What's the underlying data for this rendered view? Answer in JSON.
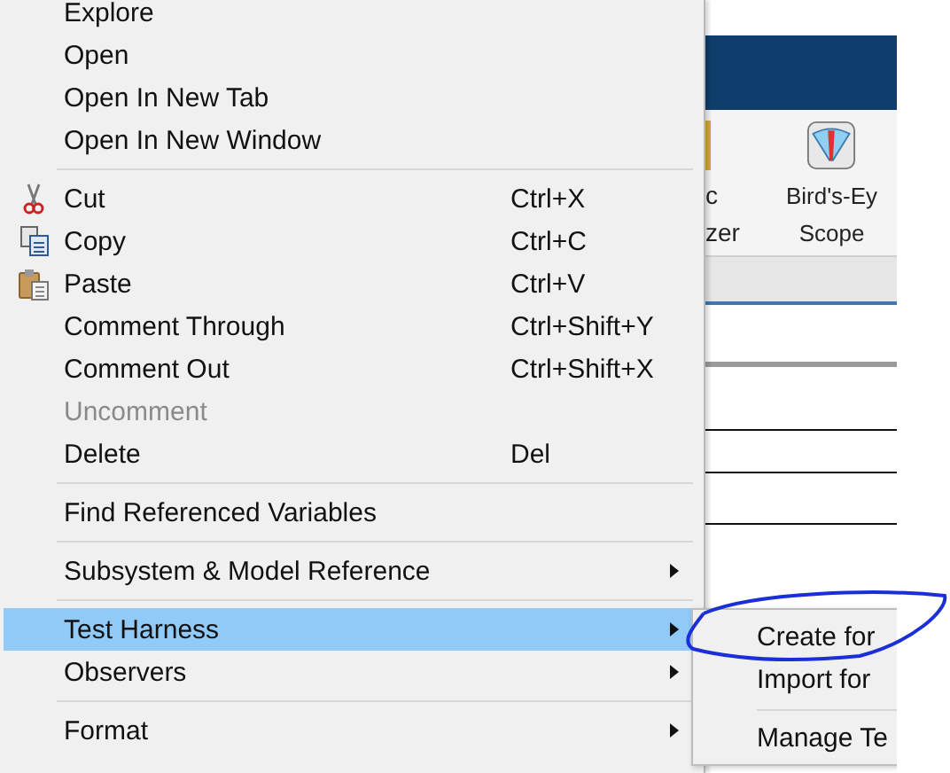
{
  "background_window": {
    "toolbar_buttons": [
      {
        "lines": [
          "c",
          "zer"
        ]
      },
      {
        "lines": [
          "Bird's-Ey",
          "Scope"
        ]
      }
    ]
  },
  "menu": {
    "items": [
      {
        "kind": "item",
        "label": "Explore",
        "disabled": false,
        "selected": false,
        "submenu": false
      },
      {
        "kind": "item",
        "label": "Open",
        "disabled": false,
        "selected": false,
        "submenu": false
      },
      {
        "kind": "item",
        "label": "Open In New Tab",
        "disabled": false,
        "selected": false,
        "submenu": false
      },
      {
        "kind": "item",
        "label": "Open In New Window",
        "disabled": false,
        "selected": false,
        "submenu": false
      },
      {
        "kind": "separator"
      },
      {
        "kind": "item",
        "label": "Cut",
        "shortcut": "Ctrl+X",
        "disabled": false,
        "selected": false,
        "submenu": false
      },
      {
        "kind": "item",
        "label": "Copy",
        "shortcut": "Ctrl+C",
        "disabled": false,
        "selected": false,
        "submenu": false
      },
      {
        "kind": "item",
        "label": "Paste",
        "shortcut": "Ctrl+V",
        "disabled": false,
        "selected": false,
        "submenu": false
      },
      {
        "kind": "item",
        "label": "Comment Through",
        "shortcut": "Ctrl+Shift+Y",
        "disabled": false,
        "selected": false,
        "submenu": false
      },
      {
        "kind": "item",
        "label": "Comment Out",
        "shortcut": "Ctrl+Shift+X",
        "disabled": false,
        "selected": false,
        "submenu": false
      },
      {
        "kind": "item",
        "label": "Uncomment",
        "disabled": true,
        "selected": false,
        "submenu": false
      },
      {
        "kind": "item",
        "label": "Delete",
        "shortcut": "Del",
        "disabled": false,
        "selected": false,
        "submenu": false
      },
      {
        "kind": "separator"
      },
      {
        "kind": "item",
        "label": "Find Referenced Variables",
        "disabled": false,
        "selected": false,
        "submenu": false
      },
      {
        "kind": "separator"
      },
      {
        "kind": "item",
        "label": "Subsystem & Model Reference",
        "disabled": false,
        "selected": false,
        "submenu": true
      },
      {
        "kind": "separator"
      },
      {
        "kind": "item",
        "label": "Test Harness",
        "disabled": false,
        "selected": true,
        "submenu": true
      },
      {
        "kind": "item",
        "label": "Observers",
        "disabled": false,
        "selected": false,
        "submenu": true
      },
      {
        "kind": "separator"
      },
      {
        "kind": "item",
        "label": "Format",
        "disabled": false,
        "selected": false,
        "submenu": true
      }
    ]
  },
  "submenu": {
    "items": [
      {
        "kind": "item",
        "label": "Create for"
      },
      {
        "kind": "item",
        "label": "Import for"
      },
      {
        "kind": "separator"
      },
      {
        "kind": "item",
        "label": "Manage Te"
      }
    ]
  }
}
